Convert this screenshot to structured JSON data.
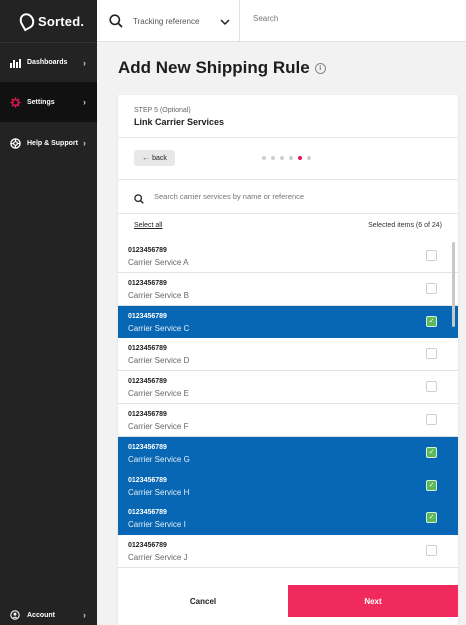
{
  "app": {
    "brand": "Sorted."
  },
  "sidebar": {
    "items": [
      {
        "label": "Dashboards",
        "icon": "dashboard-icon"
      },
      {
        "label": "Settings",
        "icon": "gear-icon"
      },
      {
        "label": "Help & Support",
        "icon": "lifebuoy-icon"
      }
    ],
    "account_label": "Account"
  },
  "topbar": {
    "tracking_placeholder": "Tracking reference",
    "search_placeholder": "Search"
  },
  "page": {
    "title": "Add New Shipping Rule"
  },
  "wizard": {
    "step_label": "STEP 5 (Optional)",
    "step_title": "Link Carrier Services",
    "back_label": "back",
    "total_steps": 6,
    "current_step": 5
  },
  "carrier_search": {
    "placeholder": "Search carrier services by name or reference"
  },
  "selection": {
    "select_all_label": "Select all",
    "selected_text": "Selected items (6 of 24)"
  },
  "services": [
    {
      "ref": "0123456789",
      "name": "Carrier Service A",
      "selected": false
    },
    {
      "ref": "0123456789",
      "name": "Carrier Service B",
      "selected": false
    },
    {
      "ref": "0123456789",
      "name": "Carrier Service C",
      "selected": true
    },
    {
      "ref": "0123456789",
      "name": "Carrier Service D",
      "selected": false
    },
    {
      "ref": "0123456789",
      "name": "Carrier Service E",
      "selected": false
    },
    {
      "ref": "0123456789",
      "name": "Carrier Service F",
      "selected": false
    },
    {
      "ref": "0123456789",
      "name": "Carrier Service G",
      "selected": true
    },
    {
      "ref": "0123456789",
      "name": "Carrier Service H",
      "selected": true
    },
    {
      "ref": "0123456789",
      "name": "Carrier Service I",
      "selected": true
    },
    {
      "ref": "0123456789",
      "name": "Carrier Service J",
      "selected": false
    }
  ],
  "actions": {
    "cancel_label": "Cancel",
    "next_label": "Next"
  },
  "colors": {
    "accent": "#f02a5c",
    "selected_row": "#0767b4",
    "check": "#5cb85c",
    "sidebar": "#232323"
  }
}
